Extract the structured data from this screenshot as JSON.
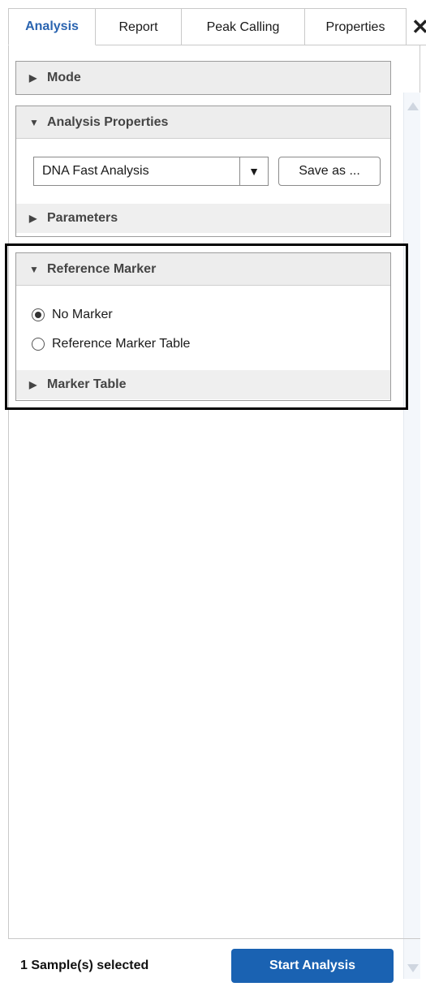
{
  "tabs": [
    {
      "label": "Analysis",
      "active": true
    },
    {
      "label": "Report",
      "active": false
    },
    {
      "label": "Peak Calling",
      "active": false
    },
    {
      "label": "Properties",
      "active": false
    }
  ],
  "close_symbol": "✕",
  "sections": {
    "mode": {
      "title": "Mode",
      "expanded": false
    },
    "analysis_properties": {
      "title": "Analysis Properties",
      "expanded": true,
      "method_value": "DNA Fast Analysis",
      "save_as_label": "Save as ...",
      "parameters": {
        "title": "Parameters",
        "expanded": false
      }
    },
    "reference_marker": {
      "title": "Reference Marker",
      "expanded": true,
      "options": [
        {
          "label": "No Marker",
          "checked": true
        },
        {
          "label": "Reference Marker Table",
          "checked": false
        }
      ],
      "marker_table": {
        "title": "Marker Table",
        "expanded": false
      }
    }
  },
  "footer": {
    "status": "1 Sample(s) selected",
    "start_label": "Start Analysis"
  },
  "colors": {
    "accent": "#1a62b2",
    "active_tab": "#2a64b0",
    "header_bg": "#ededed"
  }
}
